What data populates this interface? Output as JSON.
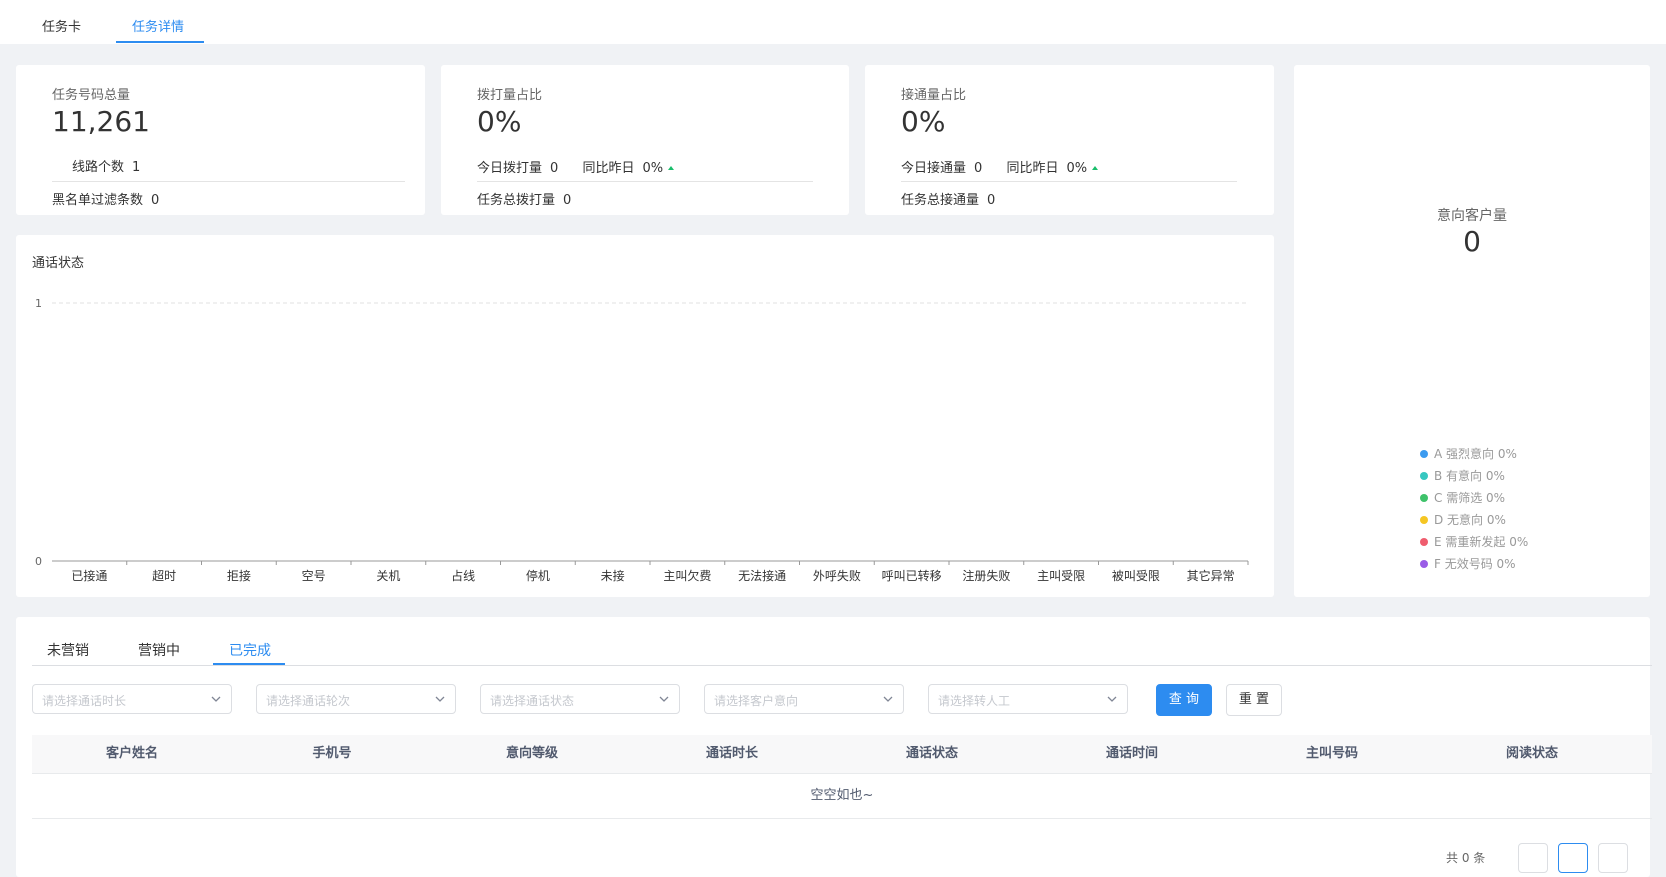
{
  "top_tabs": [
    "任务卡",
    "任务详情"
  ],
  "stats": {
    "total": {
      "title": "任务号码总量",
      "value": "11,261",
      "line_count_label": "线路个数",
      "line_count": "1",
      "blacklist_label": "黑名单过滤条数",
      "blacklist": "0"
    },
    "dial": {
      "title": "拨打量占比",
      "value": "0%",
      "today_label": "今日拨打量",
      "today": "0",
      "yoy_label": "同比昨日",
      "yoy": "0%",
      "total_label": "任务总拨打量",
      "total": "0"
    },
    "connect": {
      "title": "接通量占比",
      "value": "0%",
      "today_label": "今日接通量",
      "today": "0",
      "yoy_label": "同比昨日",
      "yoy": "0%",
      "total_label": "任务总接通量",
      "total": "0"
    }
  },
  "chart_data": {
    "type": "bar",
    "title": "通话状态",
    "categories": [
      "已接通",
      "超时",
      "拒接",
      "空号",
      "关机",
      "占线",
      "停机",
      "未接",
      "主叫欠费",
      "无法接通",
      "外呼失败",
      "呼叫已转移",
      "注册失败",
      "主叫受限",
      "被叫受限",
      "其它异常"
    ],
    "values": [
      0,
      0,
      0,
      0,
      0,
      0,
      0,
      0,
      0,
      0,
      0,
      0,
      0,
      0,
      0,
      0
    ],
    "ylim": [
      0,
      1
    ],
    "yticks": [
      "0",
      "1"
    ]
  },
  "intent": {
    "title": "意向客户量",
    "value": "0",
    "legend": [
      {
        "label": "A 强烈意向 0%",
        "color": "#3c9bf0"
      },
      {
        "label": "B 有意向 0%",
        "color": "#36c7c0"
      },
      {
        "label": "C 需筛选 0%",
        "color": "#3ec26a"
      },
      {
        "label": "D 无意向 0%",
        "color": "#f5c623"
      },
      {
        "label": "E 需重新发起 0%",
        "color": "#ef5d6e"
      },
      {
        "label": "F 无效号码 0%",
        "color": "#9a5ce6"
      }
    ]
  },
  "sub_tabs": [
    "未营销",
    "营销中",
    "已完成"
  ],
  "filters": {
    "duration": "请选择通话时长",
    "round": "请选择通话轮次",
    "status": "请选择通话状态",
    "intent": "请选择客户意向",
    "transfer": "请选择转人工"
  },
  "buttons": {
    "query": "查 询",
    "reset": "重 置"
  },
  "table": {
    "columns": [
      "客户姓名",
      "手机号",
      "意向等级",
      "通话时长",
      "通话状态",
      "通话时间",
      "主叫号码",
      "阅读状态"
    ],
    "empty_text": "空空如也~"
  },
  "pagination": {
    "text": "共 0 条"
  }
}
